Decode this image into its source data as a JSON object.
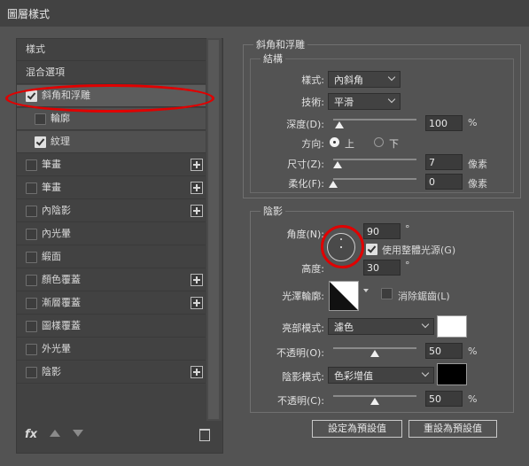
{
  "window": {
    "title": "圖層樣式"
  },
  "sidebar": {
    "items": [
      {
        "label": "樣式"
      },
      {
        "label": "混合選項"
      },
      {
        "label": "斜角和浮雕",
        "checked": true,
        "selected": true
      },
      {
        "label": "輪廓",
        "checked": false
      },
      {
        "label": "紋理",
        "checked": true
      },
      {
        "label": "筆畫",
        "checked": false,
        "has_add": true
      },
      {
        "label": "筆畫",
        "checked": false,
        "has_add": true
      },
      {
        "label": "內陰影",
        "checked": false,
        "has_add": true
      },
      {
        "label": "內光暈",
        "checked": false
      },
      {
        "label": "緞面",
        "checked": false
      },
      {
        "label": "顏色覆蓋",
        "checked": false,
        "has_add": true
      },
      {
        "label": "漸層覆蓋",
        "checked": false,
        "has_add": true
      },
      {
        "label": "圖樣覆蓋",
        "checked": false
      },
      {
        "label": "外光暈",
        "checked": false
      },
      {
        "label": "陰影",
        "checked": false,
        "has_add": true
      }
    ],
    "footer": {
      "fx": "fx"
    }
  },
  "bevel": {
    "section_title": "斜角和浮雕",
    "structure_title": "結構",
    "style_label": "樣式:",
    "style_value": "內斜角",
    "technique_label": "技術:",
    "technique_value": "平滑",
    "depth_label": "深度(D):",
    "depth_value": "100",
    "depth_unit": "%",
    "direction_label": "方向:",
    "direction_up": "上",
    "direction_down": "下",
    "direction_selected": "上",
    "size_label": "尺寸(Z):",
    "size_value": "7",
    "size_unit": "像素",
    "soften_label": "柔化(F):",
    "soften_value": "0",
    "soften_unit": "像素"
  },
  "shading": {
    "title": "陰影",
    "angle_label": "角度(N):",
    "angle_value": "90",
    "angle_unit": "°",
    "global_light_label": "使用整體光源(G)",
    "global_light_checked": true,
    "altitude_label": "高度:",
    "altitude_value": "30",
    "altitude_unit": "°",
    "gloss_label": "光澤輪廓:",
    "antialias_label": "消除鋸齒(L)",
    "antialias_checked": false,
    "highlight_mode_label": "亮部模式:",
    "highlight_mode_value": "濾色",
    "highlight_color": "#ffffff",
    "highlight_opacity_label": "不透明(O):",
    "highlight_opacity_value": "50",
    "highlight_opacity_unit": "%",
    "shadow_mode_label": "陰影模式:",
    "shadow_mode_value": "色彩增值",
    "shadow_color": "#000000",
    "shadow_opacity_label": "不透明(C):",
    "shadow_opacity_value": "50",
    "shadow_opacity_unit": "%"
  },
  "buttons": {
    "make_default": "設定為預設值",
    "reset_default": "重設為預設值"
  }
}
